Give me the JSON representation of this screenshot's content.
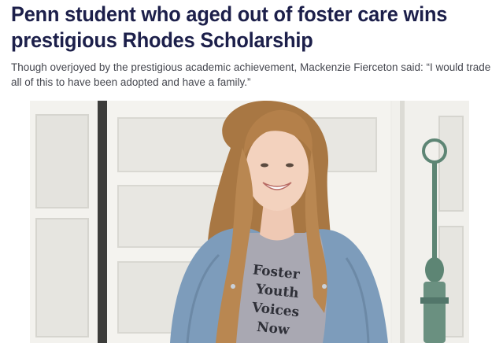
{
  "article": {
    "headline": "Penn student who aged out of foster care wins prestigious Rhodes Scholarship",
    "dek": "Though overjoyed by the prestigious academic achievement, Mackenzie Fierceton said: “I would trade all of this to have been adopted and have a family.”"
  },
  "photo": {
    "shirt_lines": [
      "Foster",
      "Youth",
      "Voices",
      "Now"
    ]
  },
  "colors": {
    "headline": "#1c1f4a",
    "dek": "#45474f",
    "door": "#f1f0ec",
    "jacket": "#7d9cbb",
    "hair": "#b4804a",
    "shirt": "#a9a8b2"
  }
}
